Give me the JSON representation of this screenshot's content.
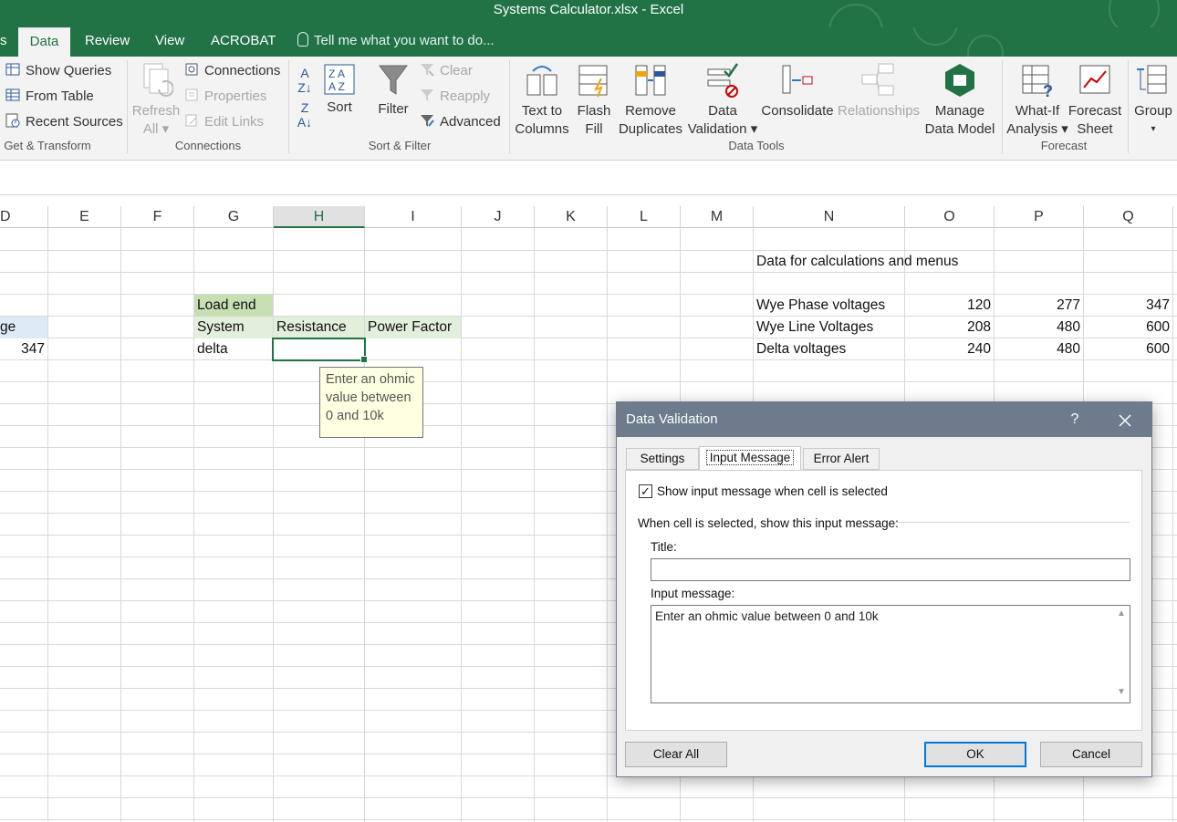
{
  "window": {
    "title": "Systems Calculator.xlsx - Excel"
  },
  "ribbon": {
    "tabs": [
      {
        "label": "s",
        "active": false
      },
      {
        "label": "Data",
        "active": true
      },
      {
        "label": "Review",
        "active": false
      },
      {
        "label": "View",
        "active": false
      },
      {
        "label": "ACROBAT",
        "active": false
      }
    ],
    "tell_me": "Tell me what you want to do...",
    "groups": {
      "get_transform": {
        "label": "Get & Transform",
        "show_queries": "Show Queries",
        "from_table": "From Table",
        "recent_sources": "Recent Sources"
      },
      "connections": {
        "label": "Connections",
        "refresh_all_line1": "Refresh",
        "refresh_all_line2": "All",
        "connections": "Connections",
        "properties": "Properties",
        "edit_links": "Edit Links"
      },
      "sort_filter": {
        "label": "Sort & Filter",
        "sort": "Sort",
        "filter": "Filter",
        "clear": "Clear",
        "reapply": "Reapply",
        "advanced": "Advanced"
      },
      "data_tools": {
        "label": "Data Tools",
        "text_to_columns_line1": "Text to",
        "text_to_columns_line2": "Columns",
        "flash_fill_line1": "Flash",
        "flash_fill_line2": "Fill",
        "remove_duplicates_line1": "Remove",
        "remove_duplicates_line2": "Duplicates",
        "data_validation_line1": "Data",
        "data_validation_line2": "Validation",
        "consolidate": "Consolidate",
        "relationships": "Relationships",
        "manage_data_model_line1": "Manage",
        "manage_data_model_line2": "Data Model"
      },
      "forecast": {
        "label": "Forecast",
        "what_if_line1": "What-If",
        "what_if_line2": "Analysis",
        "forecast_sheet_line1": "Forecast",
        "forecast_sheet_line2": "Sheet"
      },
      "outline": {
        "group": "Group"
      }
    }
  },
  "sheet": {
    "columns": [
      "D",
      "E",
      "F",
      "G",
      "H",
      "I",
      "J",
      "K",
      "L",
      "M",
      "N",
      "O",
      "P",
      "Q"
    ],
    "selected_column": "H",
    "cells": {
      "n_header": "Data for calculations and menus",
      "g_load_end": "Load end",
      "d_partial": "ge",
      "g_system": "System",
      "h_resistance": "Resistance",
      "i_power_factor": "Power Factor",
      "d_347": "347",
      "g_delta": "delta",
      "rows": [
        {
          "label": "Wye Phase voltages",
          "o": "120",
          "p": "277",
          "q": "347"
        },
        {
          "label": "Wye Line Voltages",
          "o": "208",
          "p": "480",
          "q": "600"
        },
        {
          "label": "Delta voltages",
          "o": "240",
          "p": "480",
          "q": "600"
        }
      ]
    },
    "input_tooltip": "Enter an ohmic value between 0 and 10k"
  },
  "dialog": {
    "title": "Data Validation",
    "help": "?",
    "tabs": [
      "Settings",
      "Input Message",
      "Error Alert"
    ],
    "active_tab": "Input Message",
    "show_message_checkbox": {
      "label": "Show input message when cell is selected",
      "checked": true
    },
    "section_label": "When cell is selected, show this input message:",
    "title_label": "Title:",
    "title_value": "",
    "message_label": "Input message:",
    "message_value": "Enter an ohmic value between 0 and 10k",
    "buttons": {
      "clear_all": "Clear All",
      "ok": "OK",
      "cancel": "Cancel"
    }
  },
  "colors": {
    "excel_green": "#217346",
    "dialog_title": "#6d7b8d",
    "cell_green": "#c6e0b4",
    "cell_light_green": "#e2efda",
    "cell_light_blue": "#ddebf7"
  }
}
